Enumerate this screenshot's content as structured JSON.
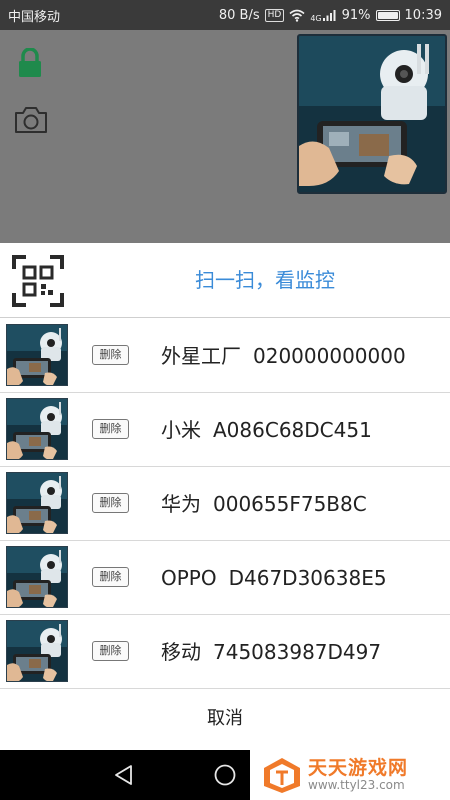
{
  "status_bar": {
    "carrier": "中国移动",
    "speed": "80 B/s",
    "hd": "HD",
    "network": "4G",
    "battery": "91%",
    "time": "10:39"
  },
  "sheet": {
    "scan_label": "扫一扫，看监控",
    "delete_label": "删除",
    "devices": [
      {
        "name": "外星工厂",
        "id": "020000000000"
      },
      {
        "name": "小米",
        "id": "A086C68DC451"
      },
      {
        "name": "华为",
        "id": "000655F75B8C"
      },
      {
        "name": "OPPO",
        "id": "D467D30638E5"
      },
      {
        "name": "移动",
        "id": "745083987D497"
      }
    ],
    "cancel_label": "取消"
  },
  "watermark": {
    "title": "天天游戏网",
    "url": "www.ttyl23.com"
  },
  "colors": {
    "accent": "#3a8bd8",
    "lock_icon": "#1f8a4c",
    "overlay": "#7b7b7b",
    "watermark": "#f07a2a"
  }
}
